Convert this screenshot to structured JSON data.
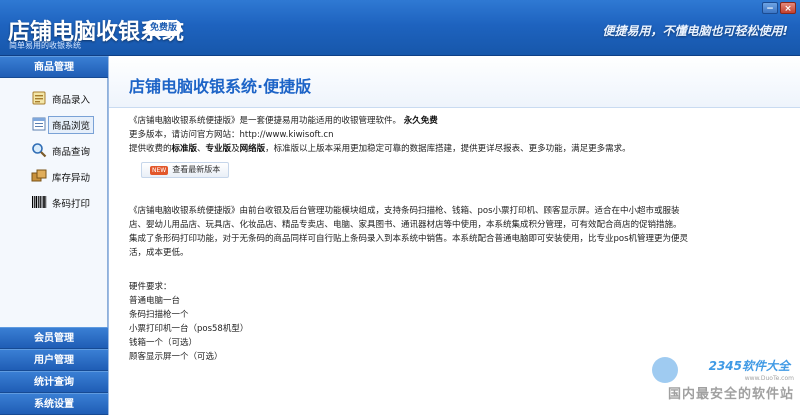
{
  "titlebar": {
    "title": "店铺电脑收银系统",
    "badge": "免费版",
    "subtitle": "简单易用的收银系统",
    "slogan": "便捷易用，不懂电脑也可轻松使用!",
    "min_label": "−",
    "close_label": "×"
  },
  "sidebar": {
    "top_section": "商品管理",
    "items": [
      {
        "label": "商品录入",
        "icon": "product-entry-icon"
      },
      {
        "label": "商品浏览",
        "icon": "product-browse-icon"
      },
      {
        "label": "商品查询",
        "icon": "search-icon"
      },
      {
        "label": "库存异动",
        "icon": "inventory-icon"
      },
      {
        "label": "条码打印",
        "icon": "barcode-icon"
      }
    ],
    "bottom_sections": [
      "会员管理",
      "用户管理",
      "统计查询",
      "系统设置"
    ]
  },
  "content": {
    "title": "店铺电脑收银系统·便捷版",
    "intro_line1_a": "《店铺电脑收银系统便捷版》是一套便捷易用功能适用的收银管理软件。",
    "intro_line1_b": "永久免费",
    "intro_line2": "更多版本，请访问官方网站：http://www.kiwisoft.cn",
    "intro_line3_a": "提供收费的",
    "intro_line3_b": "标准版",
    "intro_line3_c": "、",
    "intro_line3_d": "专业版",
    "intro_line3_e": "及",
    "intro_line3_f": "网络版",
    "intro_line3_g": "，标准版以上版本采用更加稳定可靠的数据库搭建，提供更详尽报表、更多功能，满足更多需求。",
    "update_button": "查看最新版本",
    "new_tag": "NEW",
    "description": "《店铺电脑收银系统便捷版》由前台收银及后台管理功能模块组成，支持条码扫描枪、钱箱、pos小票打印机、顾客显示屏。适合在中小超市或服装店、婴幼儿用品店、玩具店、化妆品店、精品专卖店、电脑、家具图书、通讯器材店等中使用，本系统集成积分管理，可有效配合商店的促销措施。集成了条形码打印功能，对于无条码的商品同样可自行贴上条码录入到本系统中销售。本系统配合普通电脑即可安装使用，比专业pos机管理更为便灵活，成本更低。",
    "hardware_title": "硬件要求：",
    "hardware": [
      "普通电脑一台",
      "条码扫描枪一个",
      "小票打印机一台（pos58机型）",
      "钱箱一个（可选）",
      "顾客显示屏一个（可选）"
    ]
  },
  "watermark": {
    "brand": "2345软件大全",
    "url": "www.DuoTe.com",
    "tagline": "国内最安全的软件站"
  },
  "colors": {
    "titlebar_blue": "#1e63bf",
    "title_text": "#1d64c7",
    "sidebar_header": "#1f5db5"
  }
}
